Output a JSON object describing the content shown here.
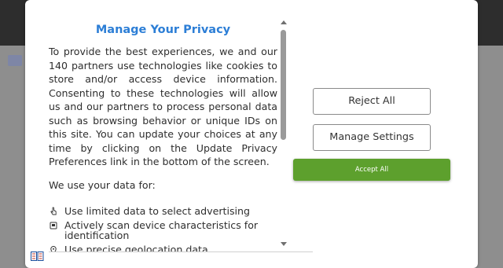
{
  "dialog": {
    "title": "Manage Your Privacy",
    "description": "To provide the best experiences, we and our 140 partners use technologies like cookies to store and/or access device information. Consenting to these technologies will allow us and our partners to process personal data such as browsing behavior or unique IDs on this site. You can update your choices at any time by clicking on the Update Privacy Preferences link in the bottom of the screen.",
    "use_heading": "We use your data for:",
    "purposes": [
      {
        "icon": "tap-hand-icon",
        "label": "Use limited data to select advertising"
      },
      {
        "icon": "device-scan-icon",
        "label": "Actively scan device characteristics for identification"
      },
      {
        "icon": "location-pin-icon",
        "label": "Use precise geolocation data"
      }
    ],
    "buttons": {
      "reject": "Reject All",
      "manage": "Manage Settings",
      "accept": "Accept All"
    },
    "colors": {
      "title": "#2c7ed6",
      "accept_bg": "#5da02d"
    }
  }
}
